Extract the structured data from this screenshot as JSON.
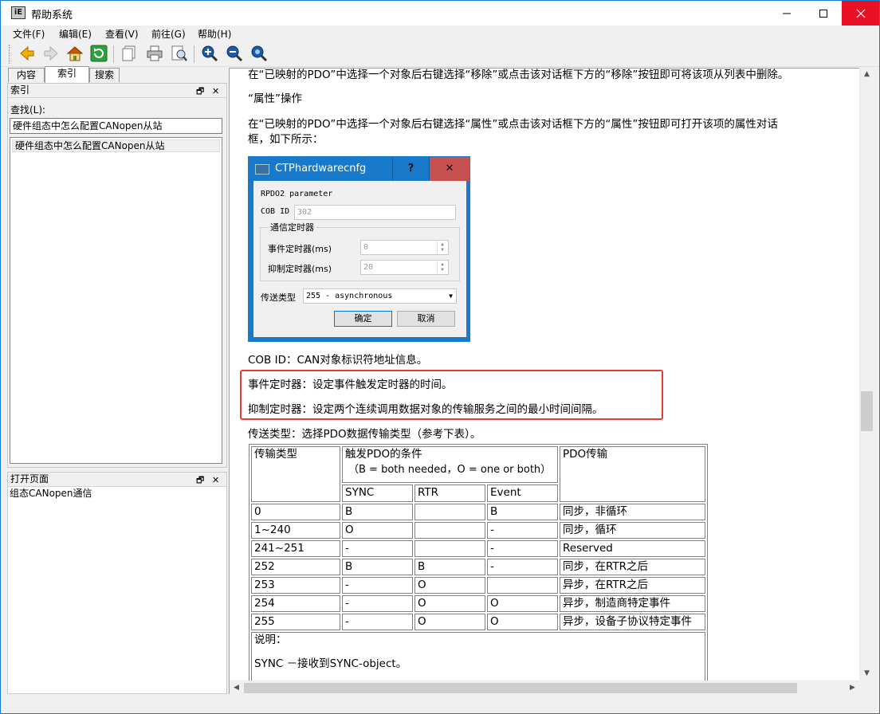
{
  "window": {
    "title": "帮助系统",
    "icon_text": "iE"
  },
  "menu": [
    "文件(F)",
    "编辑(E)",
    "查看(V)",
    "前往(G)",
    "帮助(H)"
  ],
  "toolbar": {
    "buttons": [
      "back-icon",
      "forward-icon",
      "home-icon",
      "refresh-icon",
      "copy-icon",
      "print-icon",
      "preview-icon",
      "zoom-in-icon",
      "zoom-out-icon",
      "zoom-reset-icon"
    ]
  },
  "tabs": [
    "内容",
    "索引",
    "搜索"
  ],
  "index_pane": {
    "title": "索引",
    "find_label": "查找(L):",
    "find_value": "硬件组态中怎么配置CANopen从站",
    "items": [
      "硬件组态中怎么配置CANopen从站"
    ]
  },
  "open_pane": {
    "title": "打开页面",
    "items": [
      "组态CANopen通信"
    ]
  },
  "content": {
    "p1": "在“已映射的PDO”中选择一个对象后右键选择“移除”或点击该对话框下方的“移除”按钮即可将该项从列表中删除。",
    "p2": "“属性”操作",
    "p3a": "在“已映射的PDO”中选择一个对象后右键选择“属性”或点击该对话框下方的“属性”按钮即可打开该项的属性对话",
    "p3b": "框，如下所示：",
    "p4": "COB ID：CAN对象标识符地址信息。",
    "p5": "事件定时器：设定事件触发定时器的时间。",
    "p6": "抑制定时器：设定两个连续调用数据对象的传输服务之间的最小时间间隔。",
    "p7": "传送类型：选择PDO数据传输类型（参考下表）。"
  },
  "dialog": {
    "title": "CTPhardwarecnfg",
    "help": "?",
    "close": "✕",
    "param_label": "RPDO2 parameter",
    "cob_label": "COB ID",
    "cob_value": "302",
    "group_label": "通信定时器",
    "event_label": "事件定时器(ms)",
    "event_value": "0",
    "inhibit_label": "抑制定时器(ms)",
    "inhibit_value": "20",
    "type_label": "传送类型",
    "type_value": "255 - asynchronous",
    "ok": "确定",
    "cancel": "取消"
  },
  "table": {
    "h_type": "传输类型",
    "h_cond": "触发PDO的条件",
    "h_cond_note": "（B = both needed，O = one or both）",
    "h_pdo": "PDO传输",
    "sub": [
      "SYNC",
      "RTR",
      "Event"
    ],
    "rows": [
      [
        "0",
        "B",
        "",
        "B",
        "同步，非循环"
      ],
      [
        "1~240",
        "O",
        "",
        "-",
        "同步，循环"
      ],
      [
        "241~251",
        "-",
        "",
        "-",
        "Reserved"
      ],
      [
        "252",
        "B",
        "B",
        "-",
        "同步，在RTR之后"
      ],
      [
        "253",
        "-",
        "O",
        "",
        "异步，在RTR之后"
      ],
      [
        "254",
        "-",
        "O",
        "O",
        "异步，制造商特定事件"
      ],
      [
        "255",
        "-",
        "O",
        "O",
        "异步，设备子协议特定事件"
      ]
    ],
    "note_title": "说明：",
    "note_line": "SYNC －接收到SYNC-object。"
  }
}
